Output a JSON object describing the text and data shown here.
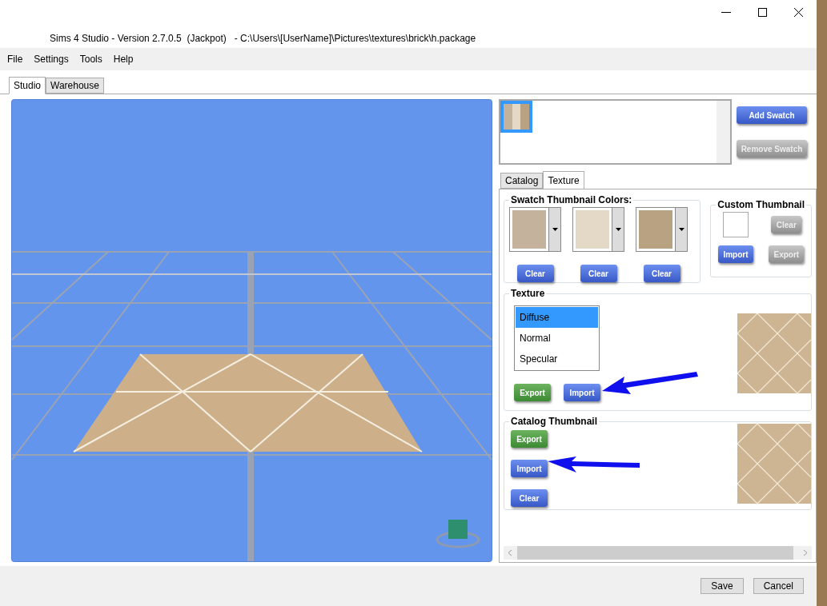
{
  "window": {
    "title": "Sims 4 Studio - Version 2.7.0.5  (Jackpot)   - C:\\Users\\[UserName]\\Pictures\\textures\\brick\\h.package"
  },
  "menu": [
    "File",
    "Settings",
    "Tools",
    "Help"
  ],
  "main_tabs": [
    {
      "label": "Studio",
      "selected": true
    },
    {
      "label": "Warehouse",
      "selected": false
    }
  ],
  "swatches": [
    {
      "selected": true
    }
  ],
  "swatch_buttons": [
    {
      "label": "Add Swatch",
      "disabled": false
    },
    {
      "label": "Remove Swatch",
      "disabled": true
    }
  ],
  "panel_tabs": [
    {
      "label": "Catalog",
      "selected": false
    },
    {
      "label": "Texture",
      "selected": true
    }
  ],
  "swatch_colors": {
    "title": "Swatch Thumbnail Colors:",
    "items": [
      {
        "color": "#c4b29d",
        "button": "Clear"
      },
      {
        "color": "#e3d9c6",
        "button": "Clear"
      },
      {
        "color": "#b8a281",
        "button": "Clear"
      }
    ]
  },
  "custom_thumbnail": {
    "title": "Custom Thumbnail",
    "buttons": [
      {
        "label": "Clear",
        "disabled": true
      },
      {
        "label": "Import",
        "disabled": false
      },
      {
        "label": "Export",
        "disabled": true
      }
    ]
  },
  "texture": {
    "title": "Texture",
    "options": [
      {
        "label": "Diffuse",
        "selected": true
      },
      {
        "label": "Normal",
        "selected": false
      },
      {
        "label": "Specular",
        "selected": false
      }
    ],
    "buttons": [
      {
        "label": "Export",
        "kind": "green",
        "disabled": false
      },
      {
        "label": "Import",
        "kind": "blue",
        "disabled": false
      }
    ]
  },
  "catalog_thumbnail": {
    "title": "Catalog Thumbnail",
    "buttons": [
      {
        "label": "Export",
        "kind": "green",
        "disabled": false
      },
      {
        "label": "Import",
        "kind": "blue",
        "disabled": false
      },
      {
        "label": "Clear",
        "kind": "blue",
        "disabled": false
      }
    ]
  },
  "footer_buttons": [
    "Save",
    "Cancel"
  ]
}
